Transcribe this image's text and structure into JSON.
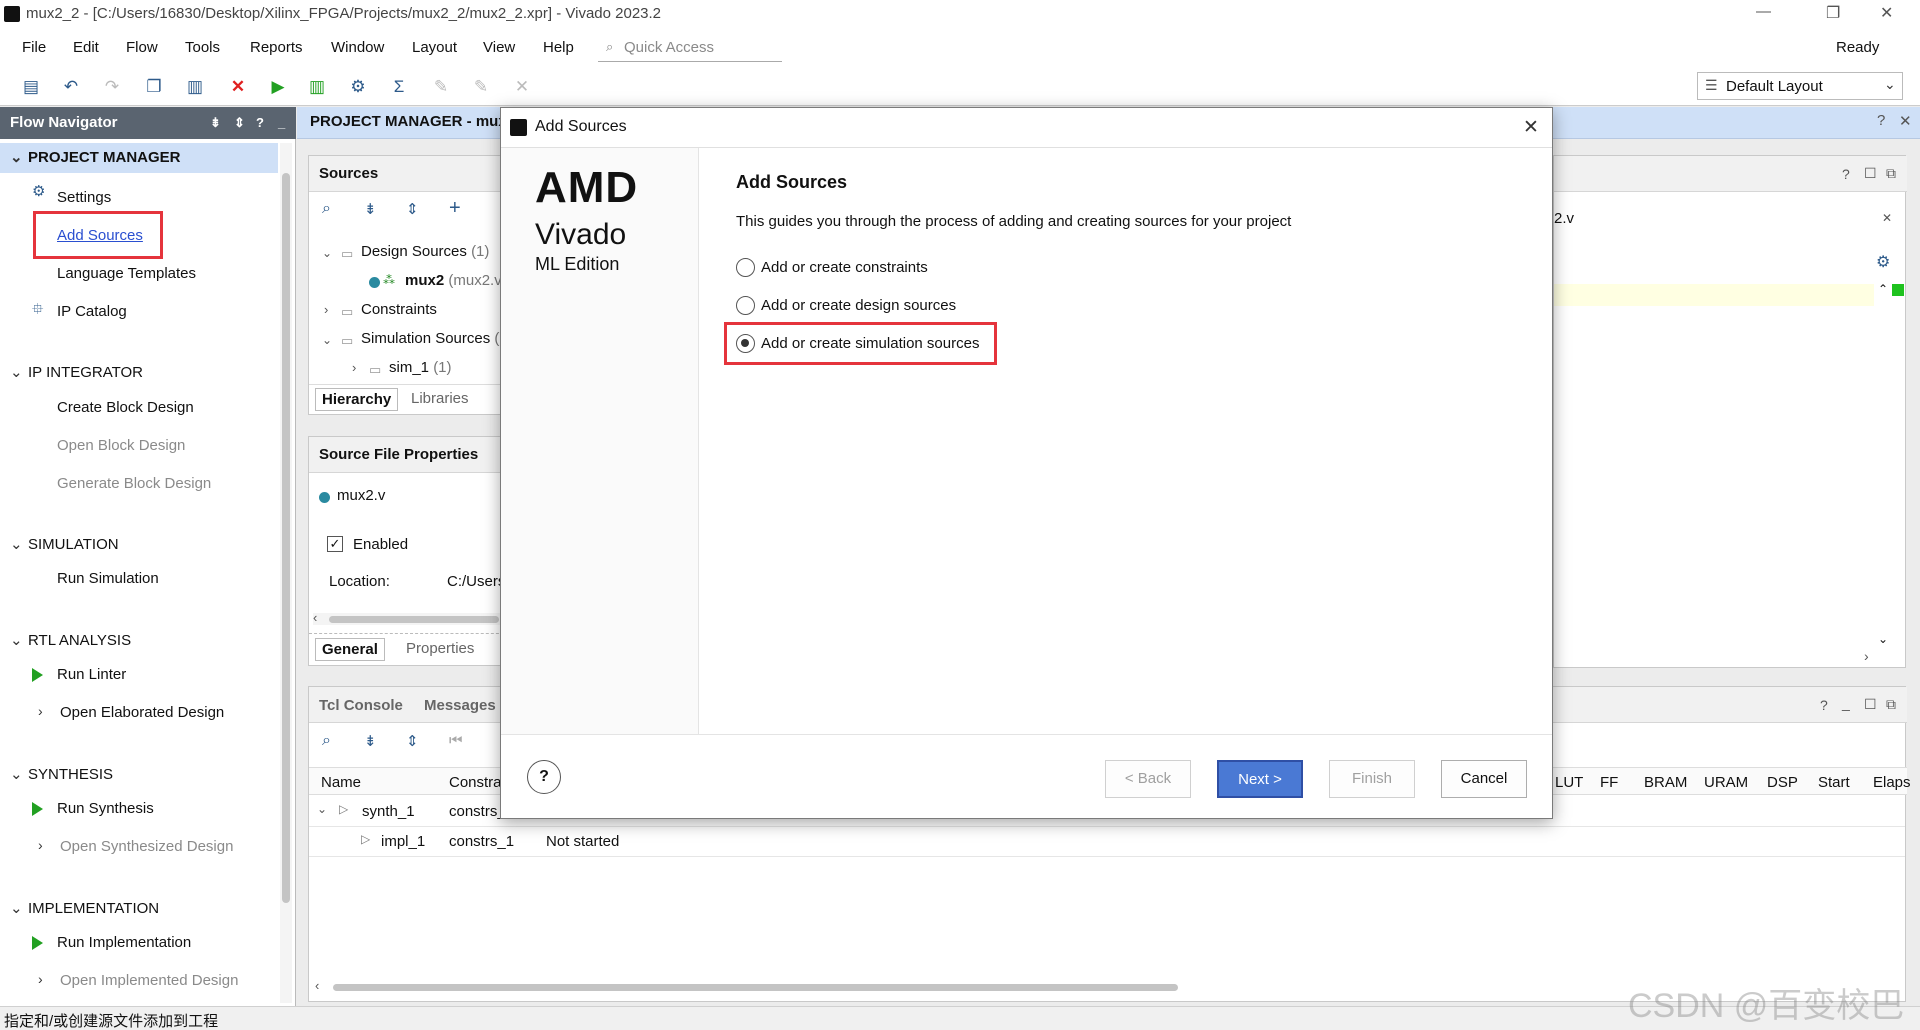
{
  "window": {
    "title": "mux2_2 - [C:/Users/16830/Desktop/Xilinx_FPGA/Projects/mux2_2/mux2_2.xpr] - Vivado 2023.2",
    "min": "—",
    "max": "❐",
    "close": "✕"
  },
  "menu": {
    "file": "File",
    "edit": "Edit",
    "flow": "Flow",
    "tools": "Tools",
    "reports": "Reports",
    "window": "Window",
    "layout": "Layout",
    "view": "View",
    "help": "Help"
  },
  "quick_access": "Quick Access",
  "status_ready": "Ready",
  "layout_selector": "Default Layout",
  "flow_navigator": {
    "title": "Flow Navigator",
    "project_manager": "PROJECT MANAGER",
    "settings": "Settings",
    "add_sources": "Add Sources",
    "language_templates": "Language Templates",
    "ip_catalog": "IP Catalog",
    "ip_integrator": "IP INTEGRATOR",
    "create_block_design": "Create Block Design",
    "open_block_design": "Open Block Design",
    "generate_block_design": "Generate Block Design",
    "simulation": "SIMULATION",
    "run_simulation": "Run Simulation",
    "rtl_analysis": "RTL ANALYSIS",
    "run_linter": "Run Linter",
    "open_elaborated_design": "Open Elaborated Design",
    "synthesis": "SYNTHESIS",
    "run_synthesis": "Run Synthesis",
    "open_synthesized_design": "Open Synthesized Design",
    "implementation": "IMPLEMENTATION",
    "run_implementation": "Run Implementation",
    "open_implemented_design": "Open Implemented Design"
  },
  "pm_header": "PROJECT MANAGER - mux",
  "sources": {
    "title": "Sources",
    "design_sources": "Design Sources",
    "design_count": "(1)",
    "mux2": "mux2",
    "mux2_file": "(mux2.v)",
    "constraints": "Constraints",
    "simulation_sources": "Simulation Sources",
    "sim_paren": "(",
    "sim_1": "sim_1",
    "sim_1_count": "(1)",
    "tab_hierarchy": "Hierarchy",
    "tab_libraries": "Libraries"
  },
  "sfp": {
    "title": "Source File Properties",
    "file": "mux2.v",
    "enabled": "Enabled",
    "location_label": "Location:",
    "location_value": "C:/Users",
    "tab_general": "General",
    "tab_properties": "Properties"
  },
  "right_pane": {
    "file_tab": "2.v"
  },
  "console": {
    "tab_tcl": "Tcl Console",
    "tab_messages": "Messages"
  },
  "runs_table": {
    "columns": [
      "Name",
      "Constra",
      "LUT",
      "FF",
      "BRAM",
      "URAM",
      "DSP",
      "Start",
      "Elaps"
    ],
    "rows": [
      {
        "name": "synth_1",
        "constraints": "constrs_",
        "status": ""
      },
      {
        "name": "impl_1",
        "constraints": "constrs_1",
        "status": "Not started"
      }
    ]
  },
  "dialog": {
    "title": "Add Sources",
    "brand": {
      "company": "AMD",
      "product": "Vivado",
      "edition": "ML Edition"
    },
    "heading": "Add Sources",
    "description": "This guides you through the process of adding and creating sources for your project",
    "options": [
      {
        "label": "Add or create constraints",
        "selected": false
      },
      {
        "label": "Add or create design sources",
        "selected": false
      },
      {
        "label": "Add or create simulation sources",
        "selected": true
      }
    ],
    "help": "?",
    "back": "< Back",
    "next": "Next >",
    "finish": "Finish",
    "cancel": "Cancel"
  },
  "statusbar": {
    "text": "指定和/或创建源文件添加到工程"
  },
  "watermark": "CSDN @百变校巴"
}
